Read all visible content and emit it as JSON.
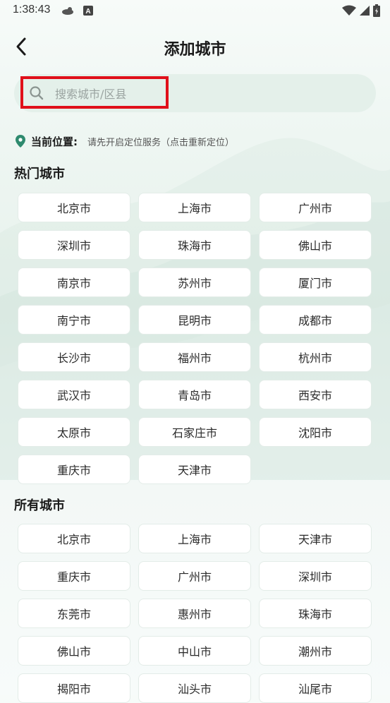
{
  "status_bar": {
    "time": "1:38:43",
    "icons": [
      "notification-icon",
      "a-badge-icon",
      "wifi-icon",
      "signal-icon",
      "battery-charging-icon"
    ]
  },
  "header": {
    "back_icon": "chevron-left-icon",
    "title": "添加城市"
  },
  "search": {
    "placeholder": "搜索城市/区县",
    "value": "",
    "icon": "search-icon",
    "highlight_color": "#e0101a"
  },
  "location": {
    "icon": "location-pin-icon",
    "label": "当前位置:",
    "value": "请先开启定位服务（点击重新定位）"
  },
  "hot_cities": {
    "title": "热门城市",
    "items": [
      "北京市",
      "上海市",
      "广州市",
      "深圳市",
      "珠海市",
      "佛山市",
      "南京市",
      "苏州市",
      "厦门市",
      "南宁市",
      "昆明市",
      "成都市",
      "长沙市",
      "福州市",
      "杭州市",
      "武汉市",
      "青岛市",
      "西安市",
      "太原市",
      "石家庄市",
      "沈阳市",
      "重庆市",
      "天津市"
    ]
  },
  "all_cities": {
    "title": "所有城市",
    "items": [
      "北京市",
      "上海市",
      "天津市",
      "重庆市",
      "广州市",
      "深圳市",
      "东莞市",
      "惠州市",
      "珠海市",
      "佛山市",
      "中山市",
      "潮州市",
      "揭阳市",
      "汕头市",
      "汕尾市"
    ]
  },
  "colors": {
    "accent_pin": "#2e8a6e",
    "background": "#eef6f2",
    "button_bg": "#ffffff"
  }
}
